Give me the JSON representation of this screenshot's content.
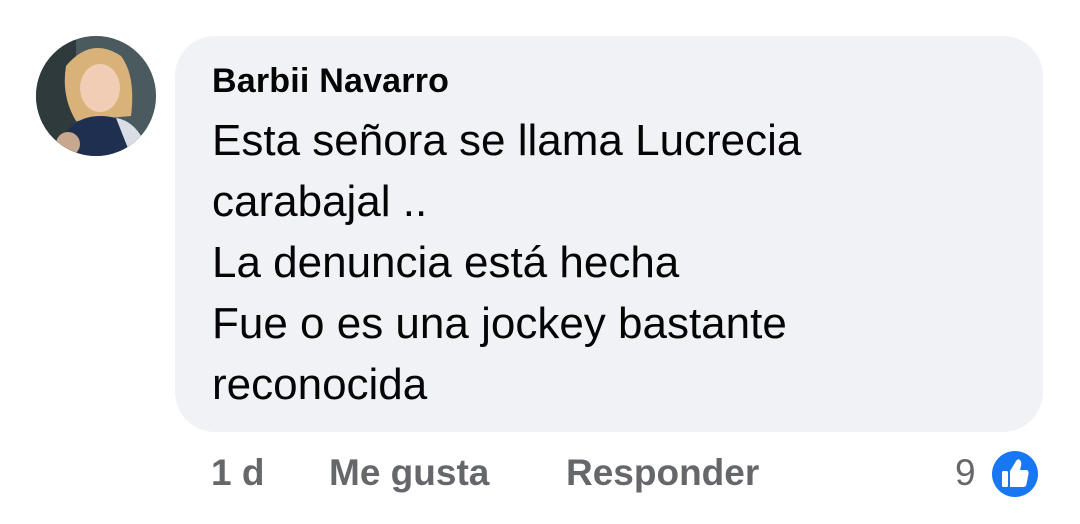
{
  "comment": {
    "author": "Barbii Navarro",
    "lines": [
      "Esta señora se llama Lucrecia",
      "carabajal ..",
      "La denuncia está hecha",
      "Fue o es una jockey bastante",
      "reconocida"
    ],
    "time": "1 d",
    "like_label": "Me gusta",
    "reply_label": "Responder",
    "reaction_count": "9",
    "reaction_icon": "like-thumbs-up-icon"
  },
  "colors": {
    "bubble_bg": "#f0f2f5",
    "text": "#050505",
    "secondary_text": "#65676b",
    "like_blue": "#1877f2"
  }
}
